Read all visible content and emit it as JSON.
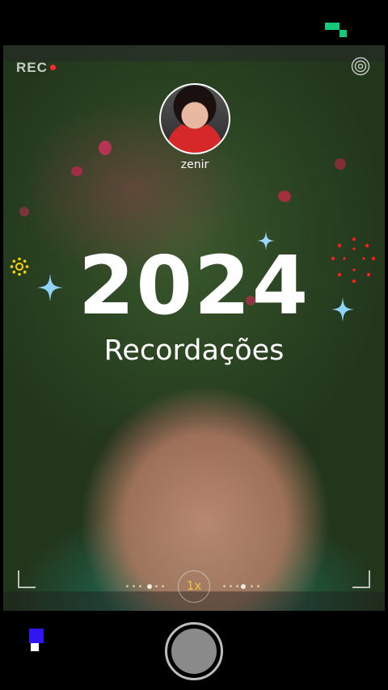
{
  "camera": {
    "rec_label": "REC",
    "rec_dot_color": "#ff2b2b",
    "settings_icon": "target-icon"
  },
  "profile": {
    "name": "zenir"
  },
  "overlay": {
    "year": "2024",
    "subtitle": "Recordações",
    "sparkle_color": "#8fd3ff",
    "sun_color": "#ffd400",
    "firework_color": "#ff1e1e"
  },
  "zoom": {
    "value": "1x"
  },
  "controls": {
    "shutter_icon": "shutter-button",
    "corner_icon": "status-pixel-icon",
    "accent_green": "#16c978",
    "accent_blue": "#3016f0"
  }
}
